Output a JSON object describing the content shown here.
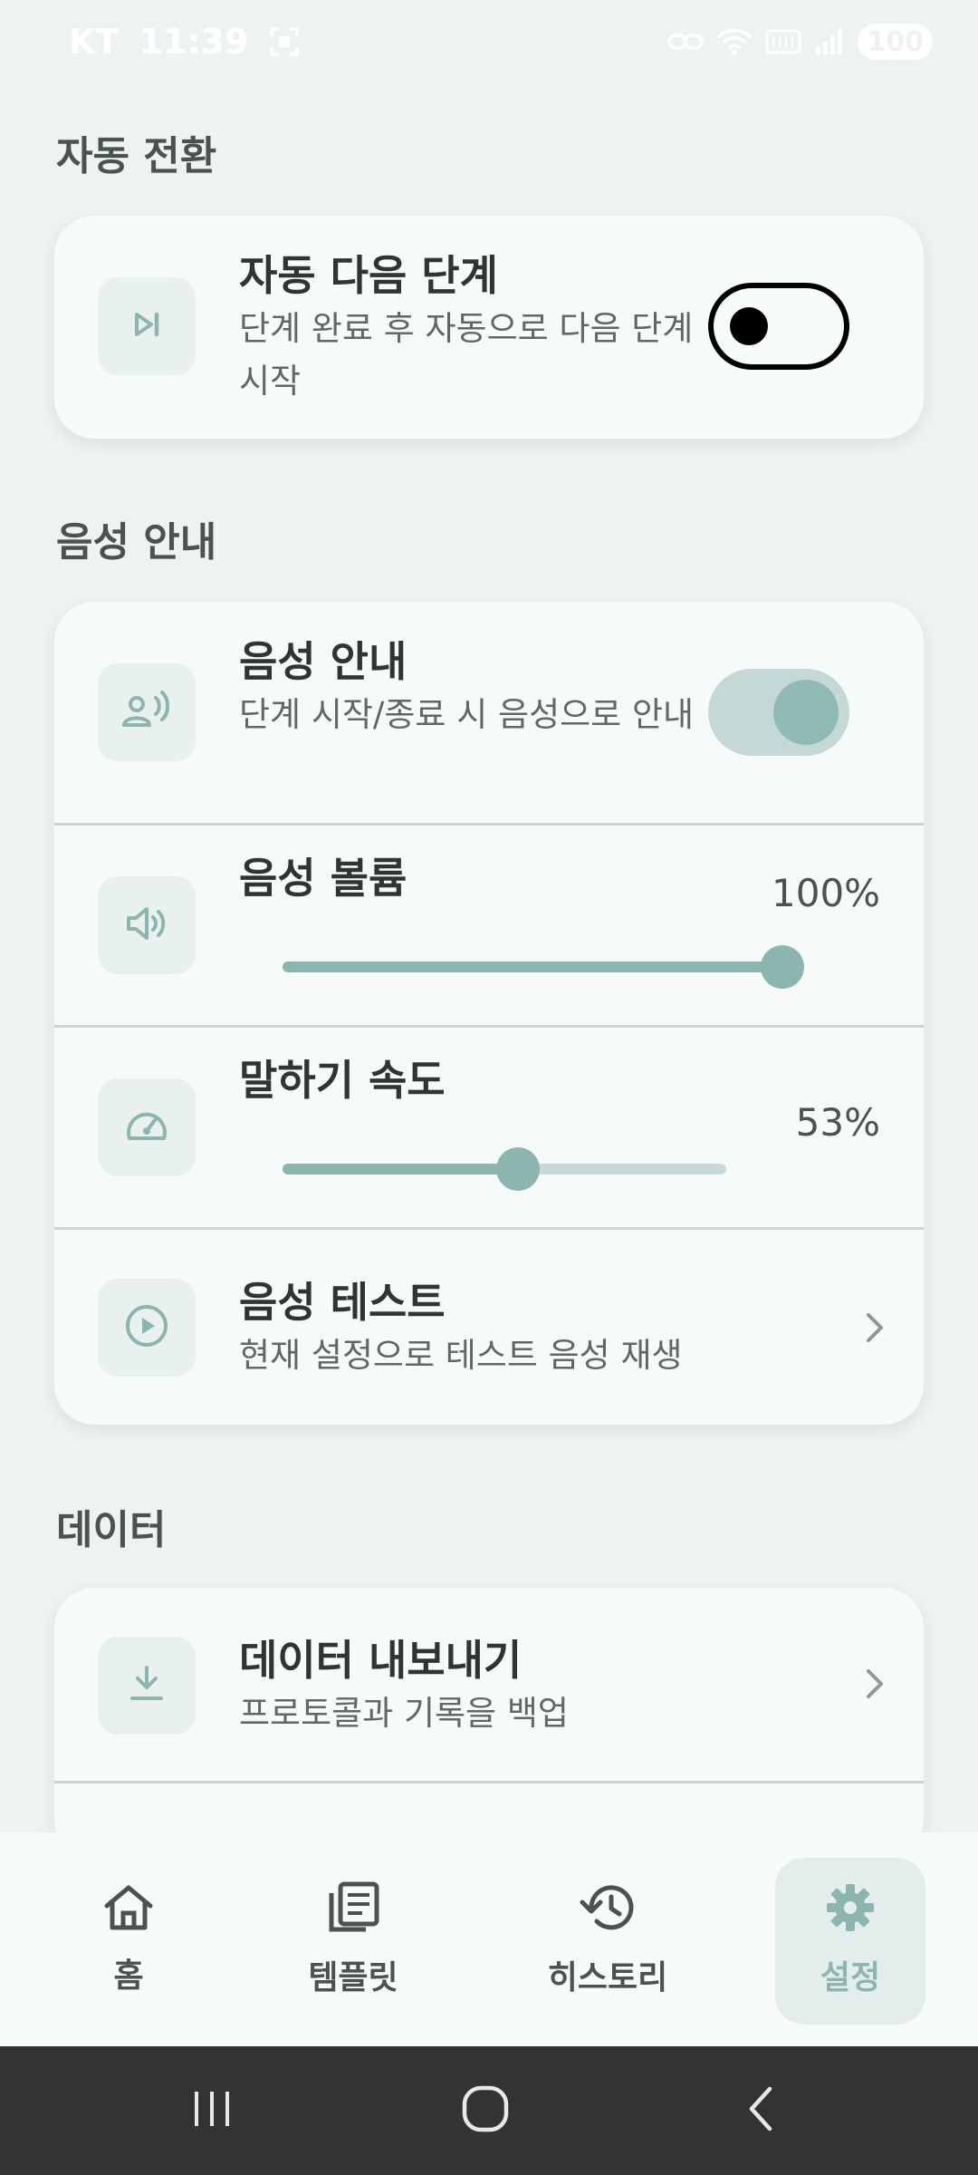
{
  "status_bar": {
    "carrier": "KT",
    "time": "11:39",
    "battery": "100"
  },
  "sections": {
    "auto_transition": {
      "title": "자동 전환",
      "auto_next": {
        "title": "자동 다음 단계",
        "subtitle": "단계 완료 후 자동으로 다음 단계 시작",
        "icon": "skip-next-icon",
        "enabled": false
      }
    },
    "voice_guide": {
      "title": "음성 안내",
      "voice_toggle": {
        "title": "음성 안내",
        "subtitle": "단계 시작/종료 시 음성으로 안내",
        "icon": "voice-person-icon",
        "enabled": true
      },
      "volume": {
        "title": "음성 볼륨",
        "value_label": "100%",
        "value": 100,
        "icon": "volume-icon"
      },
      "speed": {
        "title": "말하기 속도",
        "value_label": "53%",
        "value": 53,
        "icon": "speedometer-icon"
      },
      "test": {
        "title": "음성 테스트",
        "subtitle": "현재 설정으로 테스트 음성 재생",
        "icon": "play-circle-icon"
      }
    },
    "data": {
      "title": "데이터",
      "export": {
        "title": "데이터 내보내기",
        "subtitle": "프로토콜과 기록을 백업",
        "icon": "download-icon"
      }
    }
  },
  "bottom_nav": {
    "items": [
      {
        "label": "홈",
        "icon": "home-icon",
        "active": false
      },
      {
        "label": "템플릿",
        "icon": "template-icon",
        "active": false
      },
      {
        "label": "히스토리",
        "icon": "history-icon",
        "active": false
      },
      {
        "label": "설정",
        "icon": "gear-icon",
        "active": true
      }
    ]
  },
  "colors": {
    "background": "#ECF3F1",
    "card": "#F6FBFA",
    "accent": "#8DB5B0",
    "text_primary": "#2F3534",
    "text_secondary": "#5E6866"
  }
}
